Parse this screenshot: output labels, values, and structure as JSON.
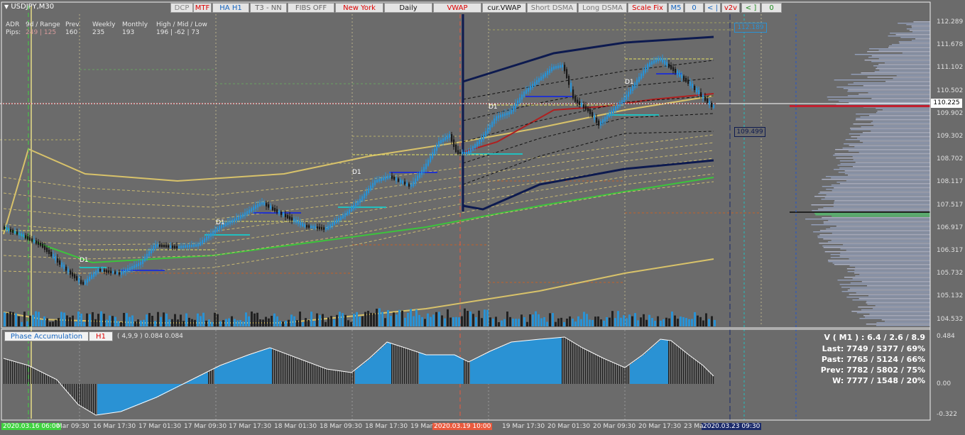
{
  "symbol": "USDJPY,M30",
  "toolbar": [
    {
      "label": "DCP",
      "color": "#888888",
      "bg": "#e4e4e4"
    },
    {
      "label": "MTF",
      "color": "#dd0000",
      "bg": "#e4e4e4"
    },
    {
      "label": "HA H1",
      "color": "#1565c0",
      "bg": "#e4e4e4"
    },
    {
      "label": "T3 - NN",
      "color": "#666666",
      "bg": "#e4e4e4"
    },
    {
      "label": "FIBS OFF",
      "color": "#666666",
      "bg": "#e4e4e4"
    },
    {
      "label": "New York",
      "color": "#dd0000",
      "bg": "#e4e4e4"
    },
    {
      "label": "Daily",
      "color": "#111111",
      "bg": "#e4e4e4"
    },
    {
      "label": "VWAP",
      "color": "#dd0000",
      "bg": "#e4e4e4"
    },
    {
      "label": "cur.VWAP",
      "color": "#111111",
      "bg": "#e4e4e4"
    },
    {
      "label": "Short DSMA",
      "color": "#777777",
      "bg": "#e4e4e4"
    },
    {
      "label": "Long DSMA",
      "color": "#777777",
      "bg": "#e4e4e4"
    },
    {
      "label": "Scale Fix",
      "color": "#dd0000",
      "bg": "#e4e4e4"
    },
    {
      "label": "M5",
      "color": "#1565c0",
      "bg": "#e4e4e4"
    },
    {
      "label": "0",
      "color": "#1565c0",
      "bg": "#e4e4e4"
    },
    {
      "label": "< |",
      "color": "#1565c0",
      "bg": "#e4e4e4"
    },
    {
      "label": "v2v",
      "color": "#dd0000",
      "bg": "#e4e4e4"
    },
    {
      "label": "< ]",
      "color": "#1b8a1b",
      "bg": "#e4e4e4"
    },
    {
      "label": "0",
      "color": "#1b8a1b",
      "bg": "#e4e4e4"
    }
  ],
  "adr": {
    "row1": [
      "ADR",
      "9d / Range",
      "Prev",
      "Weekly",
      "Monthly",
      "High / Mid / Low"
    ],
    "row2": [
      "Pips:",
      "249 | 125",
      "160",
      "235",
      "193",
      "196  |  -62  |  73"
    ]
  },
  "price_axis": [
    "112.289",
    "111.678",
    "111.102",
    "110.502",
    "109.902",
    "109.302",
    "108.702",
    "108.117",
    "107.517",
    "106.917",
    "106.317",
    "105.732",
    "105.132",
    "104.532"
  ],
  "current_price": "110.225",
  "price_tags": {
    "high": "112.189",
    "low": "109.499"
  },
  "d1_label": "D1",
  "oscillator": {
    "name": "Phase Accumulation",
    "timeframe": "H1",
    "params": "( 4,9,9 ) 0.084 0.084",
    "axis": [
      "0.484",
      "0.00",
      "-0.322"
    ]
  },
  "stats": {
    "v": "V ( M1 ) : 6.4 / 2.6 / 8.9",
    "last": "Last: 7749 / 5377 / 69%",
    "past": "Past: 7765 / 5124 / 66%",
    "prev": "Prev: 7782 / 5802 / 75%",
    "w": "W: 7777 / 1548 / 20%"
  },
  "time_axis": {
    "start": "2020.03.16 06:00",
    "labels": [
      "Mar 09:30",
      "16 Mar 17:30",
      "17 Mar 01:30",
      "17 Mar 09:30",
      "17 Mar 17:30",
      "18 Mar 01:30",
      "18 Mar 09:30",
      "18 Mar 17:30",
      "19 Mar",
      "19 Mar 17:30",
      "20 Mar 01:30",
      "20 Mar 09:30",
      "20 Mar 17:30",
      "23 Ma"
    ],
    "highlight_red": "2020.03.19 10:00",
    "highlight_blue": "2020.03.23 09:30"
  },
  "colors": {
    "bg": "#6b6b6b",
    "bull": "#2a92d4",
    "bear": "#1a1a1a",
    "vwap": "#0d1a4f",
    "ma_green": "#3cc43c",
    "ma_yellow": "#d8c26a",
    "ma_red": "#b02020"
  }
}
